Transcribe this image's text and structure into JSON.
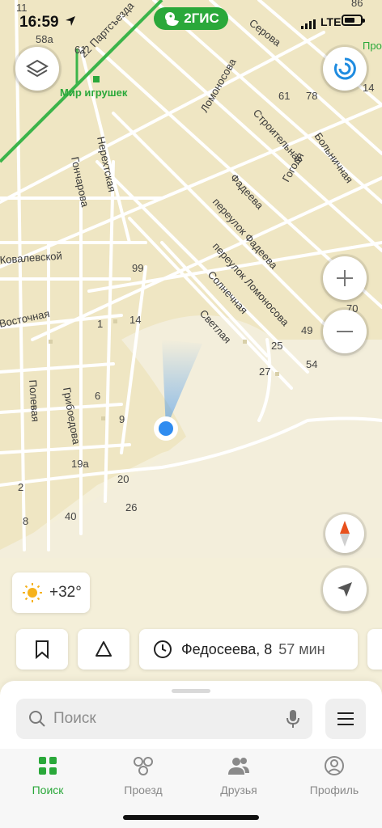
{
  "status_bar": {
    "time": "16:59",
    "network": "LTE"
  },
  "brand": {
    "name": "2ГИС",
    "color": "#2aa83a"
  },
  "map": {
    "streets": [
      "Серова",
      "Ломоносова",
      "Строительная",
      "Гоголя",
      "Больничная",
      "Фадеева",
      "переулок Фадеева",
      "переулок Ломоносова",
      "Солнечная",
      "Светлая",
      "Нерехтская",
      "Гончарова",
      "Ковалевской",
      "Восточная",
      "Полевая",
      "Грибоедова",
      "22 Партсъезда"
    ],
    "place": "Мир игрушек",
    "house_numbers": [
      "61",
      "58а",
      "11",
      "61",
      "78",
      "14",
      "99",
      "1",
      "14",
      "70",
      "49",
      "25",
      "54",
      "27",
      "6",
      "9",
      "19а",
      "20",
      "26",
      "2",
      "40",
      "8",
      "86"
    ],
    "profile_edge_text": "Проф"
  },
  "controls": {
    "layers_icon": "layers-icon",
    "zoom_in_icon": "plus-icon",
    "zoom_out_icon": "minus-icon",
    "compass_icon": "compass-icon",
    "locate_icon": "navigation-arrow-icon"
  },
  "weather": {
    "temperature": "+32°",
    "icon": "sun-icon"
  },
  "shortcuts": {
    "bookmark_icon": "bookmark-icon",
    "route_icon": "triangle-route-icon",
    "recent_place": "Федосеева, 8",
    "recent_eta": "57 мин"
  },
  "search": {
    "placeholder": "Поиск"
  },
  "tabs": [
    {
      "label": "Поиск",
      "active": true
    },
    {
      "label": "Проезд",
      "active": false
    },
    {
      "label": "Друзья",
      "active": false
    },
    {
      "label": "Профиль",
      "active": false
    }
  ],
  "colors": {
    "accent": "#2aa83a",
    "user_dot": "#2f8cf0",
    "map_bg": "#f4efd9",
    "block": "#efe6c3"
  }
}
